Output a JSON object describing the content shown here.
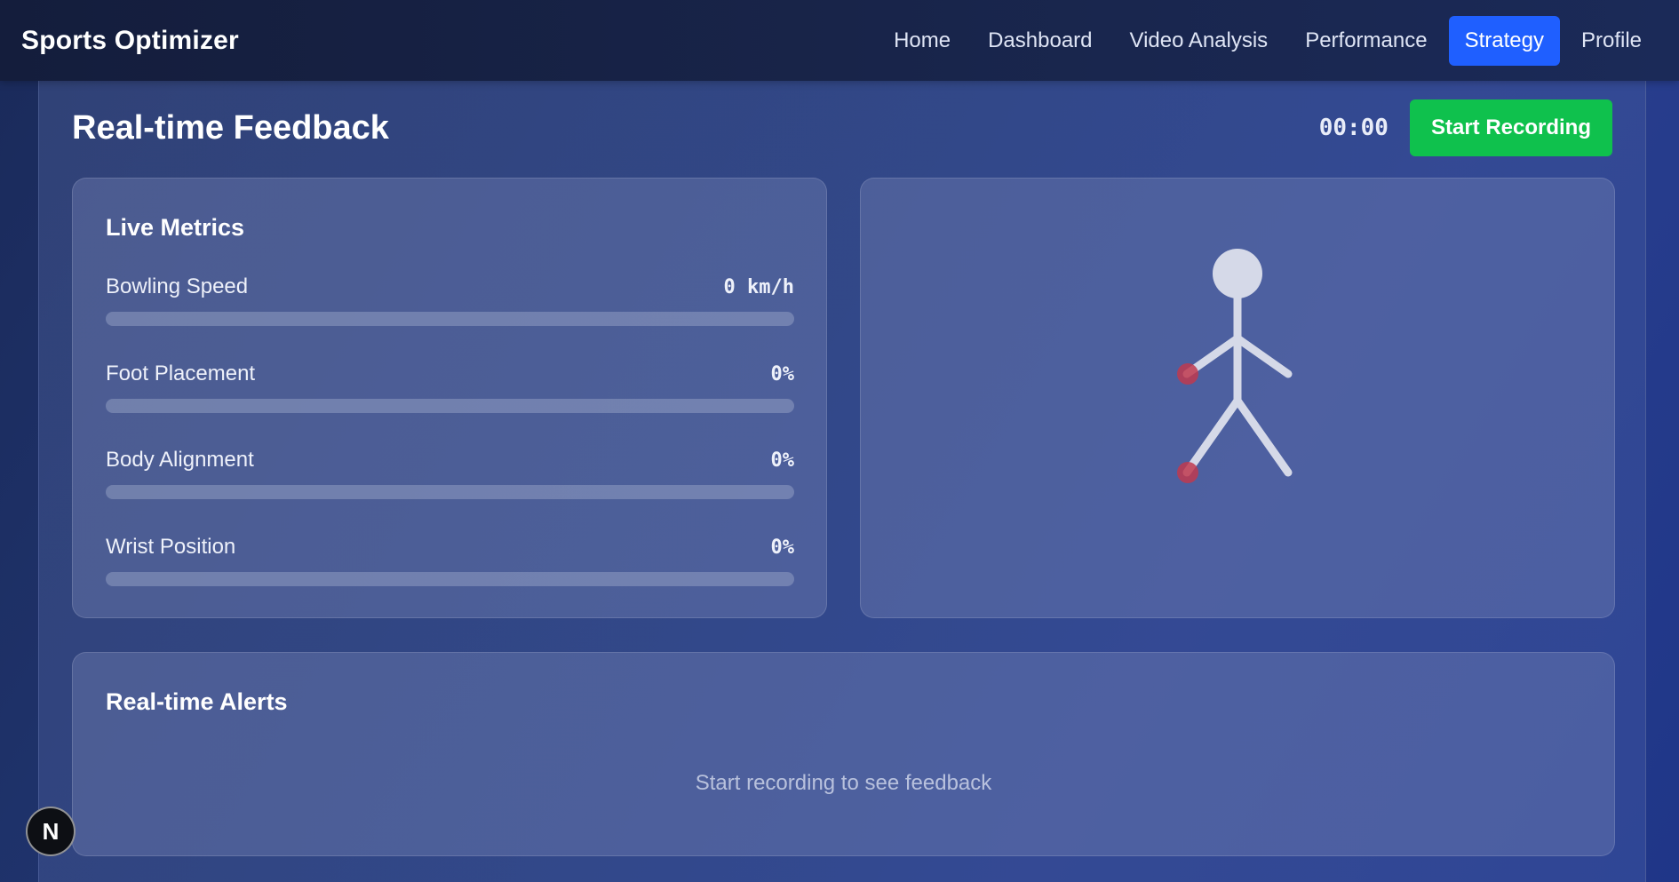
{
  "app": {
    "brand": "Sports Optimizer"
  },
  "nav": {
    "items": [
      {
        "label": "Home"
      },
      {
        "label": "Dashboard"
      },
      {
        "label": "Video Analysis"
      },
      {
        "label": "Performance"
      },
      {
        "label": "Strategy"
      },
      {
        "label": "Profile"
      }
    ],
    "active": "Strategy"
  },
  "header": {
    "title": "Real-time Feedback",
    "timer": "00:00",
    "record_button": "Start Recording"
  },
  "metrics": {
    "title": "Live Metrics",
    "items": [
      {
        "label": "Bowling Speed",
        "value": "0 km/h",
        "progress": 0
      },
      {
        "label": "Foot Placement",
        "value": "0%",
        "progress": 0
      },
      {
        "label": "Body Alignment",
        "value": "0%",
        "progress": 0
      },
      {
        "label": "Wrist Position",
        "value": "0%",
        "progress": 0
      }
    ]
  },
  "alerts": {
    "title": "Real-time Alerts",
    "empty_message": "Start recording to see feedback"
  },
  "badge": {
    "letter": "N"
  },
  "colors": {
    "active_nav": "#1f5fff",
    "record_button": "#0fc14d",
    "joint_marker": "#c0394f",
    "figure": "#d5d9e8"
  },
  "icons": {
    "figure": "stick-figure-icon",
    "badge": "n-logo-icon"
  }
}
